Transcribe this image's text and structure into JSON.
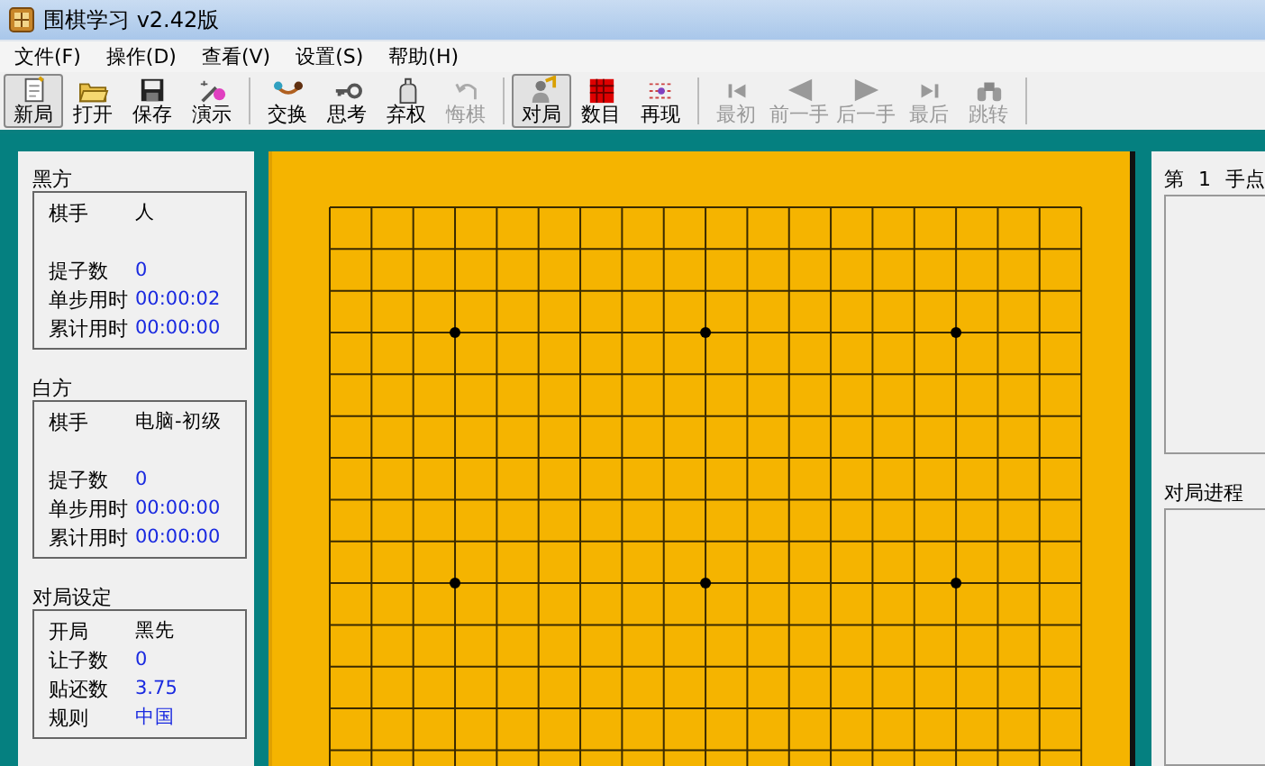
{
  "window": {
    "title": "围棋学习 v2.42版"
  },
  "menu": [
    "文件(F)",
    "操作(D)",
    "查看(V)",
    "设置(S)",
    "帮助(H)"
  ],
  "toolbar": [
    {
      "label": "新局",
      "disabled": false,
      "pressed": true
    },
    {
      "label": "打开",
      "disabled": false,
      "pressed": false
    },
    {
      "label": "保存",
      "disabled": false,
      "pressed": false
    },
    {
      "label": "演示",
      "disabled": false,
      "pressed": false,
      "separator_after": true
    },
    {
      "label": "交换",
      "disabled": false,
      "pressed": false
    },
    {
      "label": "思考",
      "disabled": false,
      "pressed": false
    },
    {
      "label": "弃权",
      "disabled": false,
      "pressed": false
    },
    {
      "label": "悔棋",
      "disabled": true,
      "pressed": false,
      "separator_after": true
    },
    {
      "label": "对局",
      "disabled": false,
      "pressed": true
    },
    {
      "label": "数目",
      "disabled": false,
      "pressed": false
    },
    {
      "label": "再现",
      "disabled": false,
      "pressed": false,
      "separator_after": true
    },
    {
      "label": "最初",
      "disabled": true,
      "pressed": false
    },
    {
      "label": "前一手",
      "disabled": true,
      "pressed": false
    },
    {
      "label": "后一手",
      "disabled": true,
      "pressed": false
    },
    {
      "label": "最后",
      "disabled": true,
      "pressed": false
    },
    {
      "label": "跳转",
      "disabled": true,
      "pressed": false,
      "separator_after": true
    }
  ],
  "sides": [
    {
      "title": "黑方",
      "player_label": "棋手",
      "player": "人",
      "rows": [
        {
          "label": "提子数",
          "value": "0"
        },
        {
          "label": "单步用时",
          "value": "00:00:02"
        },
        {
          "label": "累计用时",
          "value": "00:00:00"
        }
      ]
    },
    {
      "title": "白方",
      "player_label": "棋手",
      "player": "电脑-初级",
      "rows": [
        {
          "label": "提子数",
          "value": "0"
        },
        {
          "label": "单步用时",
          "value": "00:00:00"
        },
        {
          "label": "累计用时",
          "value": "00:00:00"
        }
      ]
    }
  ],
  "settings": {
    "title": "对局设定",
    "rows": [
      {
        "label": "开局",
        "value": "黑先",
        "emphasis": false
      },
      {
        "label": "让子数",
        "value": "0",
        "emphasis": true
      },
      {
        "label": "贴还数",
        "value": "3.75",
        "emphasis": true
      },
      {
        "label": "规则",
        "value": "中国",
        "emphasis": true
      }
    ]
  },
  "right_panel": {
    "move_label": "第",
    "move_number": "1",
    "move_suffix": "手点",
    "progress_title": "对局进程"
  }
}
